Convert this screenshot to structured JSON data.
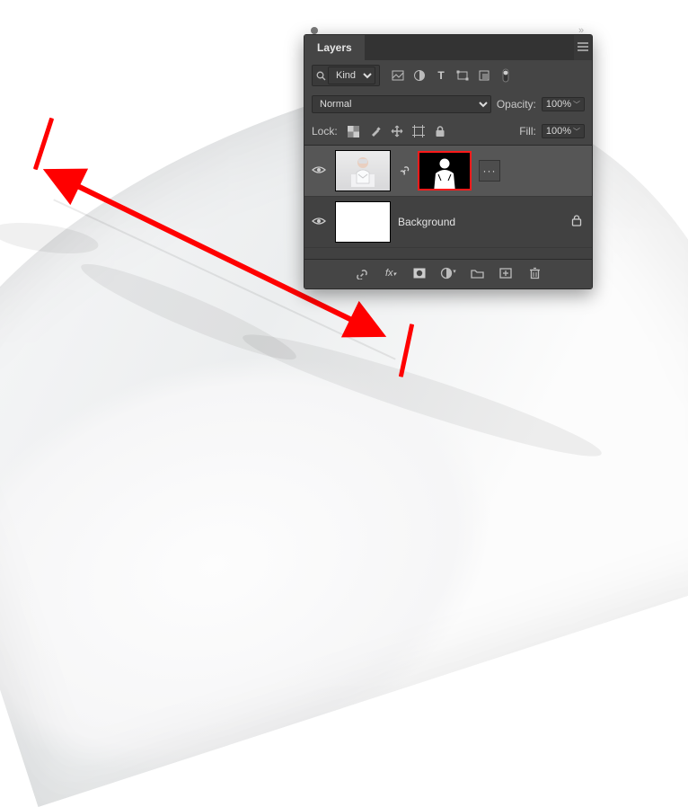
{
  "panel": {
    "title": "Layers",
    "filter": {
      "label": "Kind"
    },
    "filter_icons": [
      "pixel-layer-filter",
      "adjustment-layer-filter",
      "type-layer-filter",
      "shape-layer-filter",
      "smartobject-layer-filter"
    ],
    "blend": {
      "mode": "Normal",
      "opacity_label": "Opacity:",
      "opacity_value": "100%"
    },
    "lock": {
      "label": "Lock:",
      "fill_label": "Fill:",
      "fill_value": "100%"
    },
    "lock_icons": [
      "lock-transparency",
      "lock-paint",
      "lock-position",
      "lock-artboard",
      "lock-all"
    ],
    "layers": [
      {
        "name": "",
        "has_mask": true,
        "visible": true,
        "selected": true
      },
      {
        "name": "Background",
        "has_mask": false,
        "visible": true,
        "selected": false,
        "locked": true
      }
    ],
    "footer_icons": [
      "link-layers",
      "layer-fx",
      "add-mask",
      "adjustment-layer",
      "group-layers",
      "new-layer",
      "delete-layer"
    ]
  },
  "annotation": {
    "color": "#ff0000"
  }
}
